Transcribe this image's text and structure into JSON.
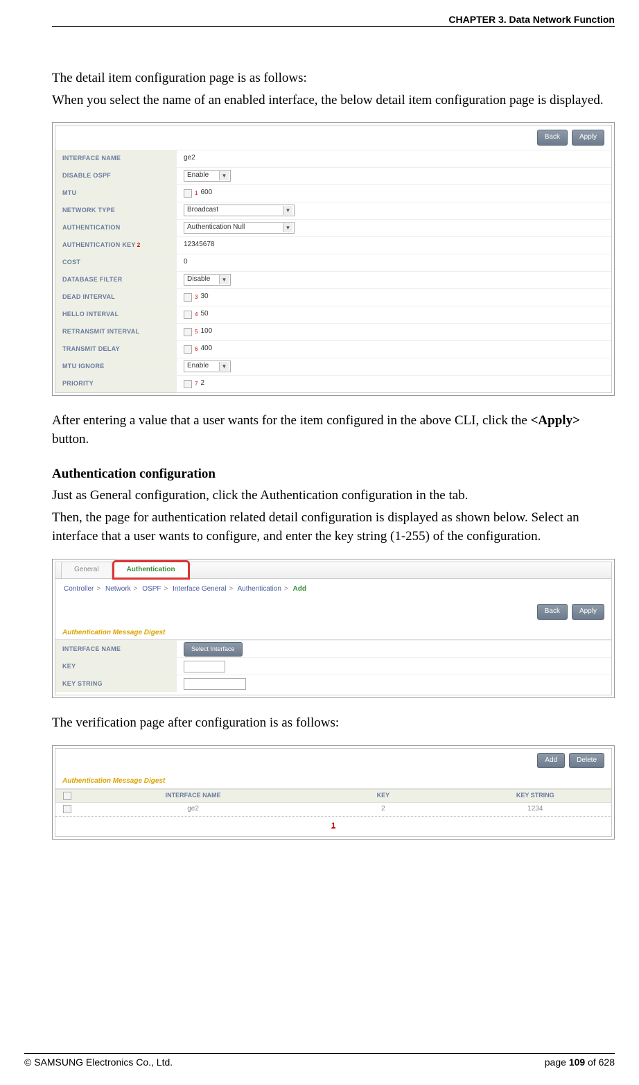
{
  "header": {
    "chapter": "CHAPTER 3. Data Network Function"
  },
  "para1": "The detail item configuration page is as follows:",
  "para2": "When you select the name of an enabled interface, the below detail item configuration page is displayed.",
  "ss1": {
    "back": "Back",
    "apply": "Apply",
    "rows": {
      "iface_lbl": "INTERFACE NAME",
      "iface_val": "ge2",
      "disospf_lbl": "DISABLE OSPF",
      "disospf_val": "Enable",
      "mtu_lbl": "MTU",
      "mtu_sup": "1",
      "mtu_val": "600",
      "ntype_lbl": "NETWORK TYPE",
      "ntype_val": "Broadcast",
      "auth_lbl": "AUTHENTICATION",
      "auth_val": "Authentication Null",
      "authkey_lbl": "AUTHENTICATION KEY",
      "authkey_sup": "2",
      "authkey_val": "12345678",
      "cost_lbl": "COST",
      "cost_val": "0",
      "dbf_lbl": "DATABASE FILTER",
      "dbf_val": "Disable",
      "dead_lbl": "DEAD INTERVAL",
      "dead_sup": "3",
      "dead_val": "30",
      "hello_lbl": "HELLO INTERVAL",
      "hello_sup": "4",
      "hello_val": "50",
      "retr_lbl": "RETRANSMIT INTERVAL",
      "retr_sup": "5",
      "retr_val": "100",
      "tdel_lbl": "TRANSMIT DELAY",
      "tdel_sup": "6",
      "tdel_val": "400",
      "mtuig_lbl": "MTU IGNORE",
      "mtuig_val": "Enable",
      "prio_lbl": "PRIORITY",
      "prio_sup": "7",
      "prio_val": "2"
    }
  },
  "para3a": "After entering a value that a user wants for the item configured in the above CLI, click the ",
  "para3b": "<Apply>",
  "para3c": " button.",
  "heading_auth": "Authentication configuration",
  "para4": "Just as General configuration, click the Authentication configuration in the tab.",
  "para5": "Then, the page for authentication related detail configuration is displayed as shown below. Select an interface that a user wants to configure, and enter the key string (1-255) of the configuration.",
  "ss2": {
    "tab_general": "General",
    "tab_auth": "Authentication",
    "crumb": {
      "c1": "Controller",
      "c2": "Network",
      "c3": "OSPF",
      "c4": "Interface General",
      "c5": "Authentication",
      "c6": "Add",
      "sep": ">"
    },
    "back": "Back",
    "apply": "Apply",
    "section": "Authentication Message Digest",
    "iface_lbl": "INTERFACE NAME",
    "iface_btn": "Select Interface",
    "key_lbl": "KEY",
    "keystr_lbl": "KEY STRING"
  },
  "para6": "The verification page after configuration is as follows:",
  "ss3": {
    "add": "Add",
    "delete": "Delete",
    "section": "Authentication Message Digest",
    "h_iface": "INTERFACE NAME",
    "h_key": "KEY",
    "h_keystr": "KEY STRING",
    "r_iface": "ge2",
    "r_key": "2",
    "r_keystr": "1234",
    "page": "1"
  },
  "footer": {
    "copyright": "© SAMSUNG Electronics Co., Ltd.",
    "page_prefix": "page ",
    "page_num": "109",
    "page_suffix": " of 628"
  }
}
